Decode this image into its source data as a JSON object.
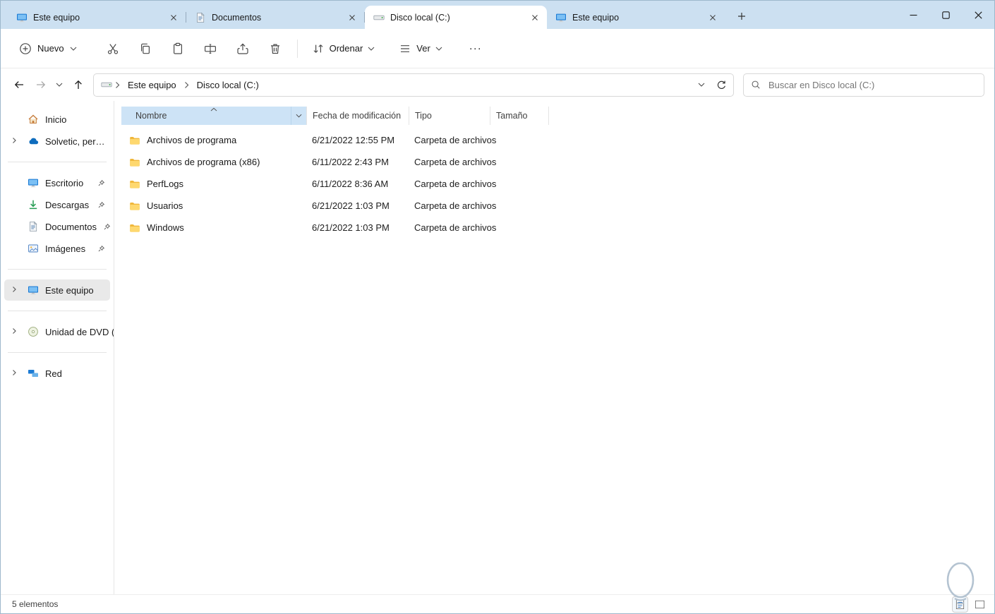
{
  "window": {
    "tabs": [
      {
        "label": "Este equipo"
      },
      {
        "label": "Documentos"
      },
      {
        "label": "Disco local (C:)"
      },
      {
        "label": "Este equipo"
      }
    ]
  },
  "toolbar": {
    "new_label": "Nuevo",
    "sort_label": "Ordenar",
    "view_label": "Ver",
    "more_label": "···"
  },
  "navigation": {
    "breadcrumb_root": "Este equipo",
    "breadcrumb_current": "Disco local (C:)",
    "search_placeholder": "Buscar en Disco local (C:)"
  },
  "sidebar": {
    "items": [
      {
        "label": "Inicio"
      },
      {
        "label": "Solvetic, personal"
      },
      {
        "label": "Escritorio"
      },
      {
        "label": "Descargas"
      },
      {
        "label": "Documentos"
      },
      {
        "label": "Imágenes"
      },
      {
        "label": "Este equipo"
      },
      {
        "label": "Unidad de DVD (D:)"
      },
      {
        "label": "Red"
      }
    ]
  },
  "file_list": {
    "columns": {
      "name": "Nombre",
      "modified": "Fecha de modificación",
      "type": "Tipo",
      "size": "Tamaño"
    },
    "rows": [
      {
        "name": "Archivos de programa",
        "modified": "6/21/2022 12:55 PM",
        "type": "Carpeta de archivos",
        "size": ""
      },
      {
        "name": "Archivos de programa (x86)",
        "modified": "6/11/2022 2:43 PM",
        "type": "Carpeta de archivos",
        "size": ""
      },
      {
        "name": "PerfLogs",
        "modified": "6/11/2022 8:36 AM",
        "type": "Carpeta de archivos",
        "size": ""
      },
      {
        "name": "Usuarios",
        "modified": "6/21/2022 1:03 PM",
        "type": "Carpeta de archivos",
        "size": ""
      },
      {
        "name": "Windows",
        "modified": "6/21/2022 1:03 PM",
        "type": "Carpeta de archivos",
        "size": ""
      }
    ]
  },
  "status_bar": {
    "items_count": "5 elementos"
  },
  "colors": {
    "titlebar_bg": "#cce0f1",
    "name_header_bg": "#cde3f6",
    "selected_sidebar_bg": "#e9e9e9",
    "folder_icon": "#f6c64a",
    "accent_blue": "#1c7bd4"
  }
}
